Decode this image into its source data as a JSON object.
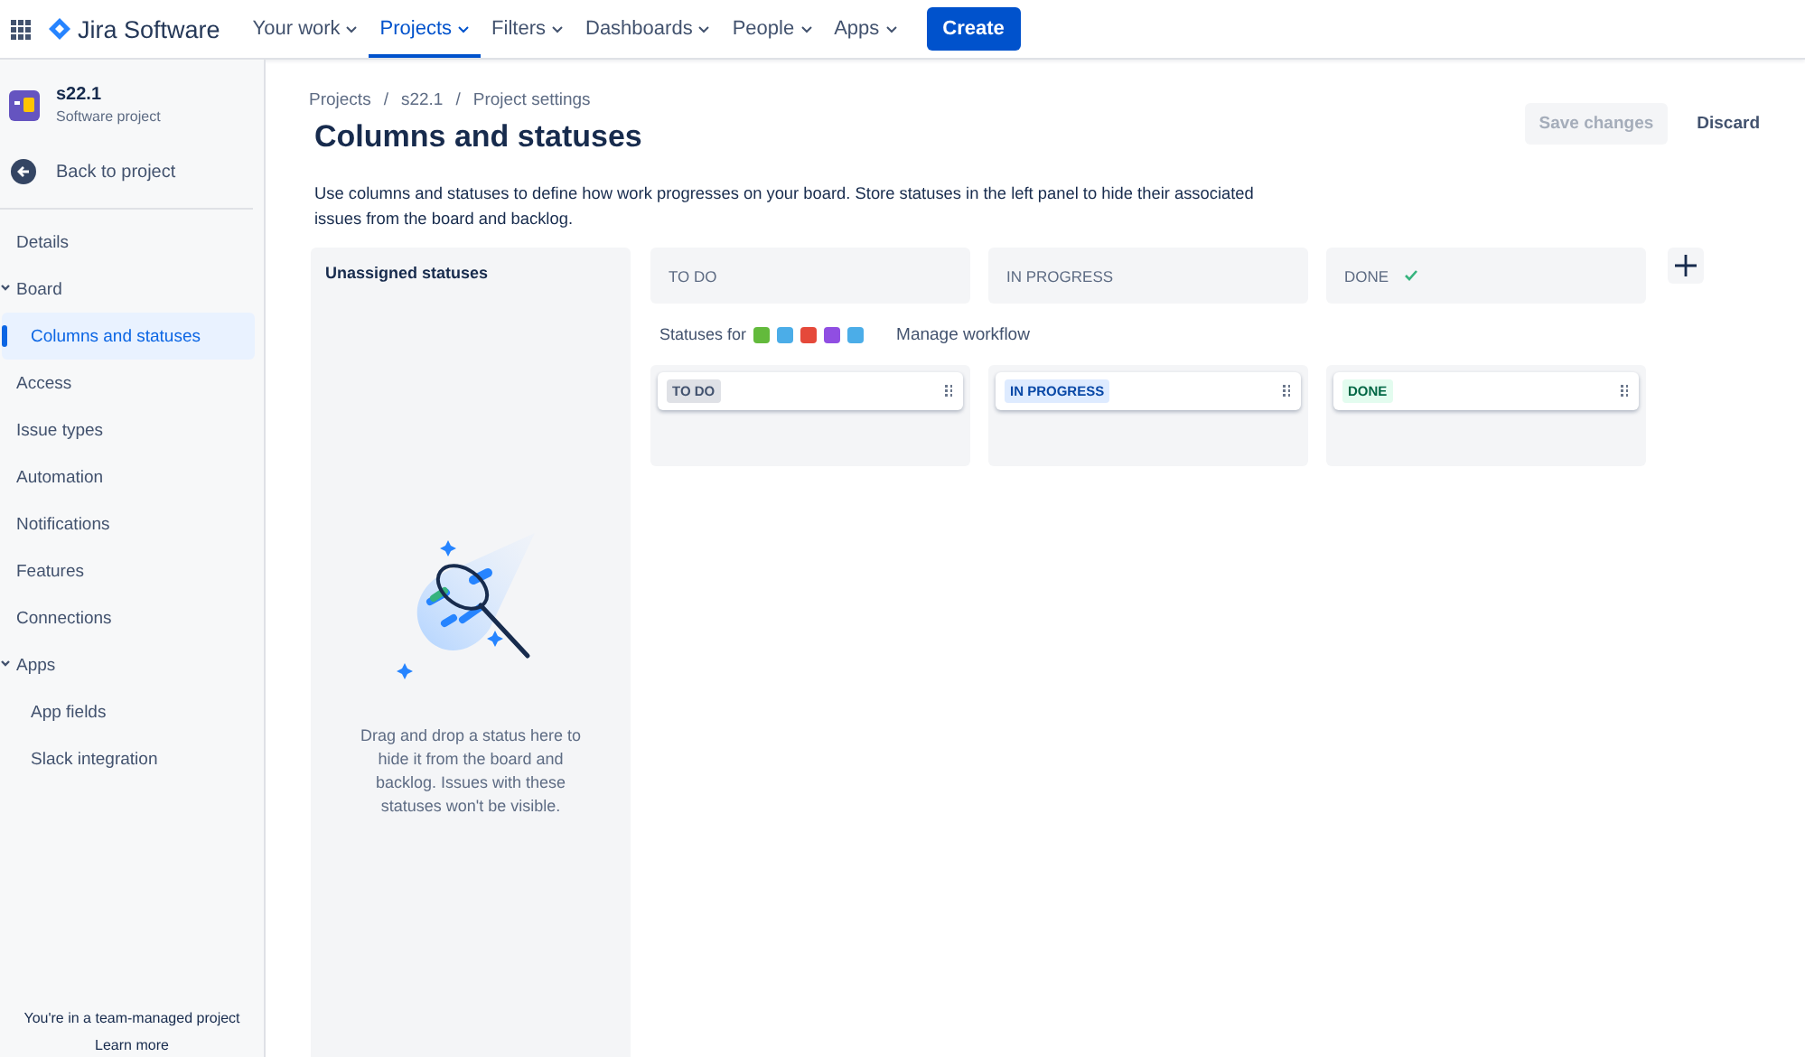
{
  "nav": {
    "product": "Jira Software",
    "items": [
      {
        "label": "Your work",
        "selected": false
      },
      {
        "label": "Projects",
        "selected": true
      },
      {
        "label": "Filters",
        "selected": false
      },
      {
        "label": "Dashboards",
        "selected": false
      },
      {
        "label": "People",
        "selected": false
      },
      {
        "label": "Apps",
        "selected": false
      }
    ],
    "create": "Create"
  },
  "sidebar": {
    "project": {
      "name": "s22.1",
      "type": "Software project"
    },
    "back": "Back to project",
    "items": [
      {
        "label": "Details",
        "selected": false
      },
      {
        "label": "Board",
        "selected": false,
        "expanded": true,
        "children": [
          {
            "label": "Columns and statuses",
            "selected": true
          }
        ]
      },
      {
        "label": "Access",
        "selected": false
      },
      {
        "label": "Issue types",
        "selected": false
      },
      {
        "label": "Automation",
        "selected": false
      },
      {
        "label": "Notifications",
        "selected": false
      },
      {
        "label": "Features",
        "selected": false
      },
      {
        "label": "Connections",
        "selected": false
      },
      {
        "label": "Apps",
        "selected": false,
        "expanded": true,
        "children": [
          {
            "label": "App fields",
            "selected": false
          },
          {
            "label": "Slack integration",
            "selected": false
          }
        ]
      }
    ],
    "footer": "You're in a team-managed project",
    "footer_link": "Learn more"
  },
  "breadcrumbs": [
    {
      "label": "Projects"
    },
    {
      "separator": "/",
      "label": "s22.1"
    },
    {
      "separator": "/",
      "label": "Project settings"
    }
  ],
  "title": "Columns and statuses",
  "actions": [
    {
      "label": "Save changes",
      "disabled": true
    },
    {
      "label": "Discard",
      "disabled": false
    }
  ],
  "description": "Use columns and statuses to define how work progresses on your board. Store statuses in the left panel to hide their associated issues from the board and backlog.",
  "unassigned": {
    "title": "Unassigned statuses",
    "message": "Drag and drop a status here to hide it from the board and backlog. Issues with these statuses won't be visible."
  },
  "statuses_for": {
    "label": "Statuses for",
    "issue_types": [
      {
        "color": "#63ba3c"
      },
      {
        "color": "#4bade8"
      },
      {
        "color": "#e5493a"
      },
      {
        "color": "#904ee2"
      },
      {
        "color": "#4bade8"
      }
    ],
    "link": "Manage workflow"
  },
  "columns": [
    {
      "title": "TO DO",
      "done": false,
      "statuses": [
        {
          "label": "TO DO",
          "kind": "todo"
        }
      ]
    },
    {
      "title": "IN PROGRESS",
      "done": false,
      "statuses": [
        {
          "label": "IN PROGRESS",
          "kind": "inprogress"
        }
      ]
    },
    {
      "title": "DONE",
      "done": true,
      "statuses": [
        {
          "label": "DONE",
          "kind": "done"
        }
      ]
    }
  ]
}
